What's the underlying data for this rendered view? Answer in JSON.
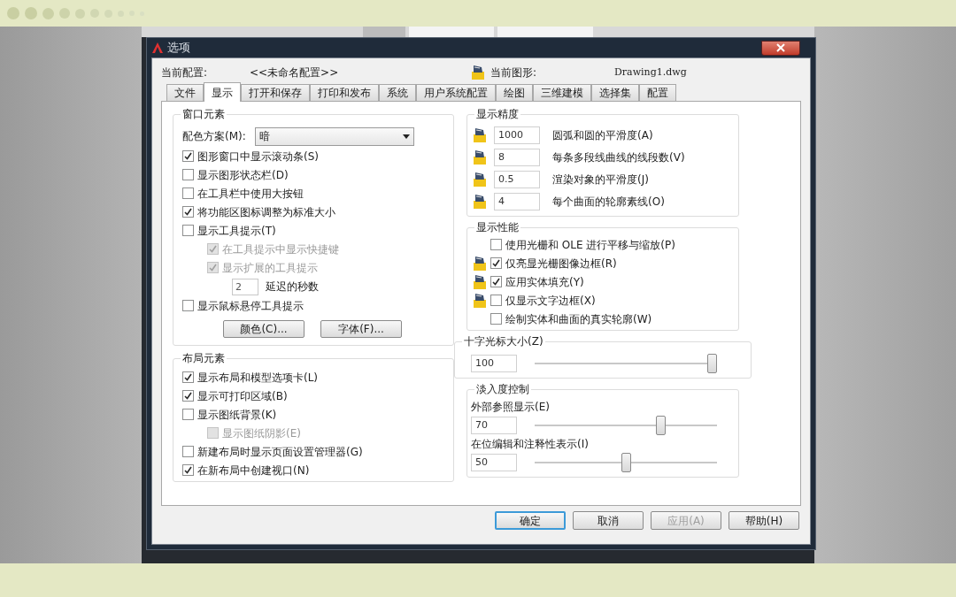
{
  "window": {
    "title": "选项"
  },
  "profile": {
    "label": "当前配置:",
    "value": "<<未命名配置>>"
  },
  "drawing": {
    "label": "当前图形:",
    "value": "Drawing1.dwg"
  },
  "tabs": [
    {
      "label": "文件",
      "selected": false
    },
    {
      "label": "显示",
      "selected": true
    },
    {
      "label": "打开和保存",
      "selected": false
    },
    {
      "label": "打印和发布",
      "selected": false
    },
    {
      "label": "系统",
      "selected": false
    },
    {
      "label": "用户系统配置",
      "selected": false
    },
    {
      "label": "绘图",
      "selected": false
    },
    {
      "label": "三维建模",
      "selected": false
    },
    {
      "label": "选择集",
      "selected": false
    },
    {
      "label": "配置",
      "selected": false
    }
  ],
  "window_elements": {
    "title": "窗口元素",
    "color_scheme": {
      "label": "配色方案(M):",
      "value": "暗"
    },
    "checkboxes": [
      {
        "label": "图形窗口中显示滚动条(S)",
        "checked": true,
        "disabled": false
      },
      {
        "label": "显示图形状态栏(D)",
        "checked": false,
        "disabled": false
      },
      {
        "label": "在工具栏中使用大按钮",
        "checked": false,
        "disabled": false
      },
      {
        "label": "将功能区图标调整为标准大小",
        "checked": true,
        "disabled": false
      },
      {
        "label": "显示工具提示(T)",
        "checked": false,
        "disabled": false,
        "children": [
          {
            "label": "在工具提示中显示快捷键",
            "checked": true,
            "disabled": true
          },
          {
            "label": "显示扩展的工具提示",
            "checked": true,
            "disabled": true
          }
        ],
        "delay": {
          "value": "2",
          "label": "延迟的秒数"
        }
      },
      {
        "label": "显示鼠标悬停工具提示",
        "checked": false,
        "disabled": false
      }
    ],
    "buttons": [
      "颜色(C)...",
      "字体(F)..."
    ]
  },
  "layout_elements": {
    "title": "布局元素",
    "checkboxes": [
      {
        "label": "显示布局和模型选项卡(L)",
        "checked": true,
        "disabled": false
      },
      {
        "label": "显示可打印区域(B)",
        "checked": true,
        "disabled": false
      },
      {
        "label": "显示图纸背景(K)",
        "checked": false,
        "disabled": false,
        "children": [
          {
            "label": "显示图纸阴影(E)",
            "checked": false,
            "disabled": true
          }
        ]
      },
      {
        "label": "新建布局时显示页面设置管理器(G)",
        "checked": false,
        "disabled": false
      },
      {
        "label": "在新布局中创建视口(N)",
        "checked": true,
        "disabled": false
      }
    ]
  },
  "display_resolution": {
    "title": "显示精度",
    "rows": [
      {
        "value": "1000",
        "label": "圆弧和圆的平滑度(A)"
      },
      {
        "value": "8",
        "label": "每条多段线曲线的线段数(V)"
      },
      {
        "value": "0.5",
        "label": "渲染对象的平滑度(J)"
      },
      {
        "value": "4",
        "label": "每个曲面的轮廓素线(O)"
      }
    ]
  },
  "display_performance": {
    "title": "显示性能",
    "checkboxes": [
      {
        "label": "使用光栅和 OLE 进行平移与缩放(P)",
        "checked": false,
        "drawing_icon": false
      },
      {
        "label": "仅亮显光栅图像边框(R)",
        "checked": true,
        "drawing_icon": true
      },
      {
        "label": "应用实体填充(Y)",
        "checked": true,
        "drawing_icon": true
      },
      {
        "label": "仅显示文字边框(X)",
        "checked": false,
        "drawing_icon": true
      },
      {
        "label": "绘制实体和曲面的真实轮廓(W)",
        "checked": false,
        "drawing_icon": false
      }
    ]
  },
  "crosshair": {
    "title": "十字光标大小(Z)",
    "value": "100",
    "level": 1,
    "highlighted": true
  },
  "fade": {
    "title": "淡入度控制",
    "sliders": [
      {
        "label": "外部参照显示(E)",
        "value": "70",
        "level": 0.7
      },
      {
        "label": "在位编辑和注释性表示(I)",
        "value": "50",
        "level": 0.5
      }
    ]
  },
  "buttons": [
    {
      "label": "确定",
      "default": true,
      "disabled": false
    },
    {
      "label": "取消",
      "default": false,
      "disabled": false
    },
    {
      "label": "应用(A)",
      "default": false,
      "disabled": true
    },
    {
      "label": "帮助(H)",
      "default": false,
      "disabled": false
    }
  ]
}
